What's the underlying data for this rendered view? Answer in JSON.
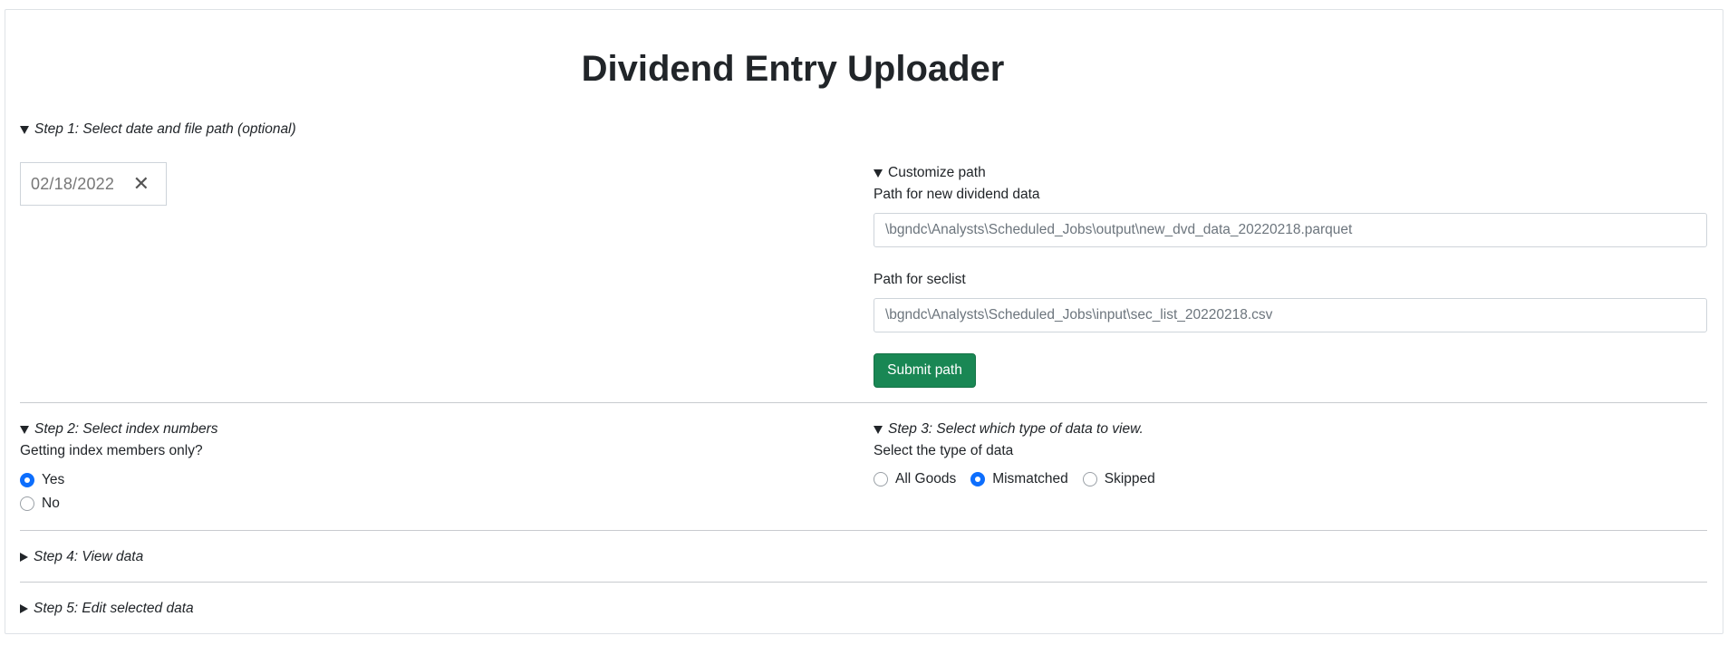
{
  "title": "Dividend Entry Uploader",
  "step1": {
    "summary": "Step 1: Select date and file path (optional)",
    "date_value": "02/18/2022",
    "clear_glyph": "✕",
    "customize": {
      "summary": "Customize path",
      "dvd_label": "Path for new dividend data",
      "dvd_path": "\\bgndc\\Analysts\\Scheduled_Jobs\\output\\new_dvd_data_20220218.parquet",
      "seclist_label": "Path for seclist",
      "seclist_path": "\\bgndc\\Analysts\\Scheduled_Jobs\\input\\sec_list_20220218.csv",
      "submit_label": "Submit path"
    }
  },
  "step2": {
    "summary": "Step 2: Select index numbers",
    "question": "Getting index members only?",
    "options": [
      {
        "label": "Yes",
        "checked": true
      },
      {
        "label": "No",
        "checked": false
      }
    ]
  },
  "step3": {
    "summary": "Step 3: Select which type of data to view.",
    "question": "Select the type of data",
    "options": [
      {
        "label": "All Goods",
        "checked": false
      },
      {
        "label": "Mismatched",
        "checked": true
      },
      {
        "label": "Skipped",
        "checked": false
      }
    ]
  },
  "step4": {
    "summary": "Step 4: View data"
  },
  "step5": {
    "summary": "Step 5: Edit selected data"
  },
  "colors": {
    "primary": "#0d6efd",
    "success": "#198754",
    "border": "#dee2e6"
  }
}
